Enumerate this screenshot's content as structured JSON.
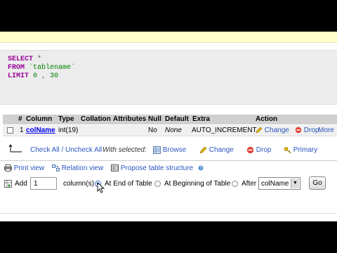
{
  "sql": {
    "select_kw": "SELECT",
    "select_rest": "*",
    "from_kw": "FROM",
    "from_rest": "`tablename`",
    "limit_kw": "LIMIT",
    "limit_a": "0",
    "limit_b": "30"
  },
  "table": {
    "headers": [
      "#",
      "Column",
      "Type",
      "Collation",
      "Attributes",
      "Null",
      "Default",
      "Extra",
      "Action"
    ],
    "row": {
      "num": "1",
      "column": "colName",
      "type": "int(19)",
      "null": "No",
      "default": "None",
      "extra": "AUTO_INCREMENT",
      "change": "Change",
      "drop": "Drop",
      "more": "More"
    }
  },
  "checkall": {
    "label": "Check All / Uncheck All",
    "with_selected": "With selected:",
    "browse": "Browse",
    "change": "Change",
    "drop": "Drop",
    "primary": "Primary"
  },
  "tools": {
    "print_view": "Print view",
    "relation_view": "Relation view",
    "propose": "Propose table structure"
  },
  "add": {
    "label": "Add",
    "count": "1",
    "columns": "column(s)",
    "at_end": "At End of Table",
    "at_begin": "At Beginning of Table",
    "after": "After",
    "after_value": "colName",
    "go": "Go"
  }
}
